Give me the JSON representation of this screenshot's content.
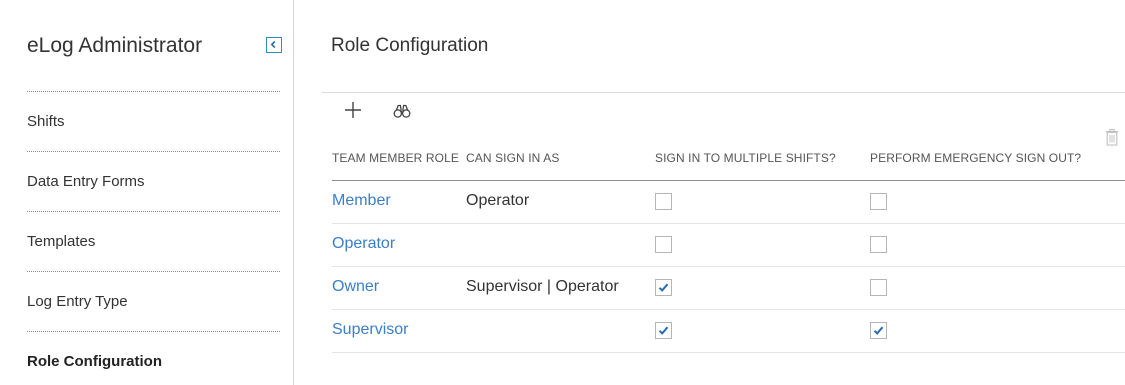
{
  "sidebar": {
    "title": "eLog Administrator",
    "collapse_icon": "chevron-left-icon",
    "items": [
      {
        "label": "Shifts",
        "active": false
      },
      {
        "label": "Data Entry Forms",
        "active": false
      },
      {
        "label": "Templates",
        "active": false
      },
      {
        "label": "Log Entry Type",
        "active": false
      },
      {
        "label": "Role Configuration",
        "active": true
      }
    ]
  },
  "main": {
    "title": "Role Configuration",
    "toolbar": {
      "add_icon": "plus-icon",
      "search_icon": "binoculars-icon",
      "delete_icon": "trash-icon"
    },
    "table": {
      "columns": [
        "TEAM MEMBER ROLE",
        "CAN SIGN IN AS",
        "SIGN IN TO MULTIPLE SHIFTS?",
        "PERFORM EMERGENCY SIGN OUT?"
      ],
      "rows": [
        {
          "role": "Member",
          "can_sign_in_as": "Operator",
          "multiple_shifts": false,
          "emergency_sign_out": false
        },
        {
          "role": "Operator",
          "can_sign_in_as": "",
          "multiple_shifts": false,
          "emergency_sign_out": false
        },
        {
          "role": "Owner",
          "can_sign_in_as": "Supervisor | Operator",
          "multiple_shifts": true,
          "emergency_sign_out": false
        },
        {
          "role": "Supervisor",
          "can_sign_in_as": "",
          "multiple_shifts": true,
          "emergency_sign_out": true
        }
      ]
    }
  },
  "colors": {
    "accent": "#3b7ec8",
    "checkbox_check": "#2b6cb0",
    "collapse_border": "#2a8fbd"
  }
}
